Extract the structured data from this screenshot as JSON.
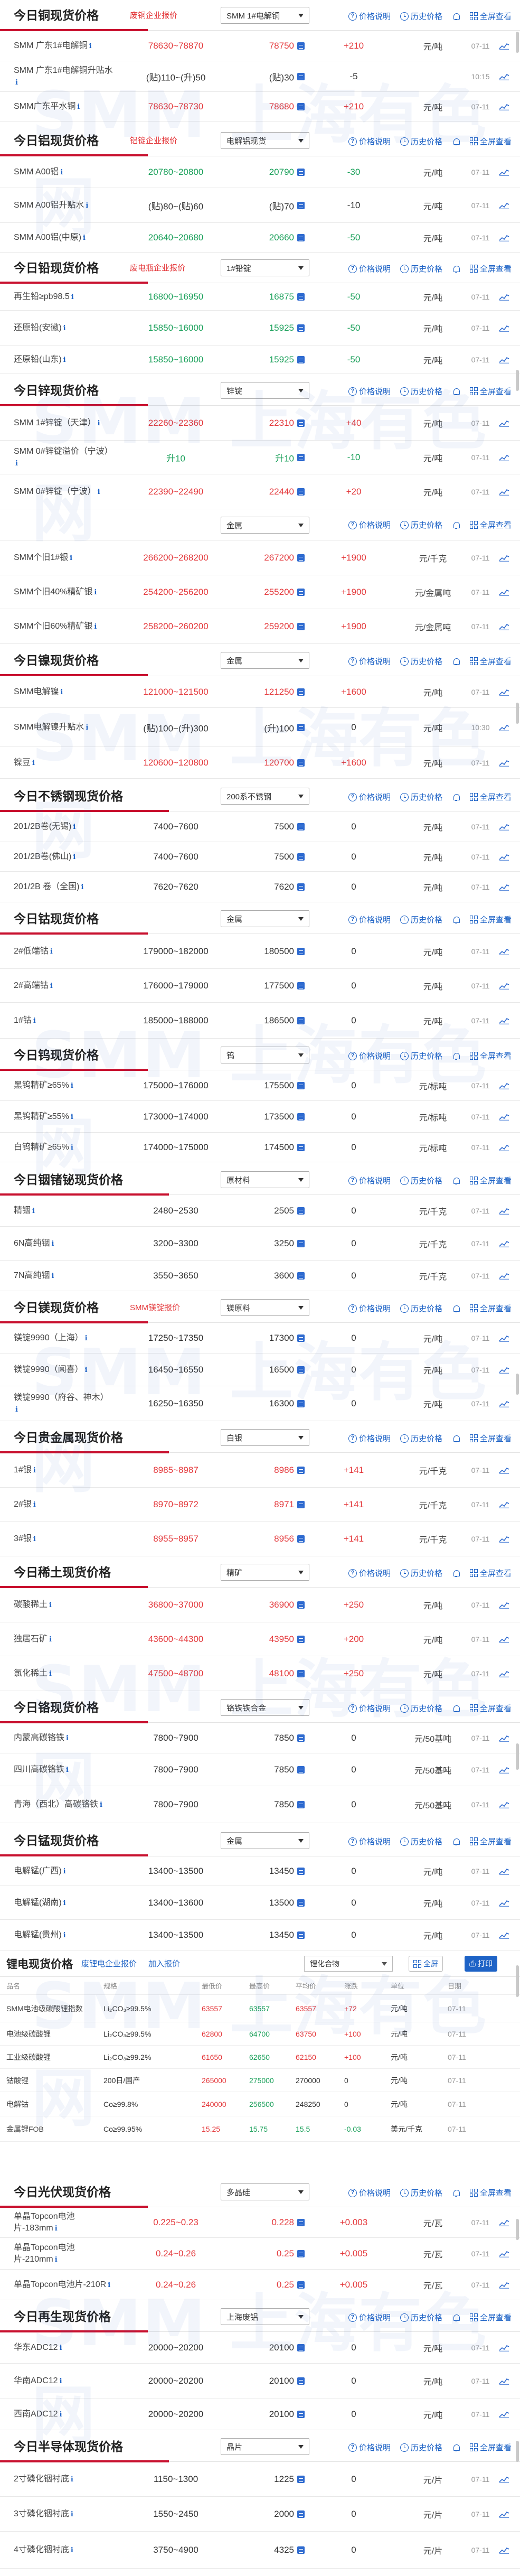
{
  "common": {
    "help": "价格说明",
    "history": "历史价格",
    "fullscreen": "全屏查看"
  },
  "copper": {
    "title": "今日铜现货价格",
    "link": "废铜企业报价",
    "select": "SMM 1#电解铜",
    "rows": [
      {
        "name": "SMM 广东1#电解铜",
        "range": "78630~78870",
        "avg": "78750",
        "chg": "+210",
        "unit": "元/吨",
        "date": "07-11",
        "dir": "up"
      },
      {
        "name": "SMM 广东1#电解铜升贴水",
        "range": "(贴)110~(升)50",
        "avg": "(贴)30",
        "chg": "-5",
        "unit": "",
        "date": "10:15",
        "dir": "none"
      },
      {
        "name": "SMM广东平水铜",
        "range": "78630~78730",
        "avg": "78680",
        "chg": "+210",
        "unit": "元/吨",
        "date": "07-11",
        "dir": "up"
      }
    ]
  },
  "aluminum": {
    "title": "今日铝现货价格",
    "link": "铝锭企业报价",
    "select": "电解铝现货",
    "rows": [
      {
        "name": "SMM A00铝",
        "range": "20780~20800",
        "avg": "20790",
        "chg": "-30",
        "unit": "元/吨",
        "date": "07-11",
        "dir": "down"
      },
      {
        "name": "SMM A00铝升贴水",
        "range": "(贴)80~(贴)60",
        "avg": "(贴)70",
        "chg": "-10",
        "unit": "元/吨",
        "date": "07-11",
        "dir": "none"
      },
      {
        "name": "SMM A00铝(中原)",
        "range": "20640~20680",
        "avg": "20660",
        "chg": "-50",
        "unit": "元/吨",
        "date": "07-11",
        "dir": "down"
      }
    ]
  },
  "lead": {
    "title": "今日铅现货价格",
    "link": "废电瓶企业报价",
    "select": "1#铅锭",
    "rows": [
      {
        "name": "再生铅≥pb98.5",
        "range": "16800~16950",
        "avg": "16875",
        "chg": "-50",
        "unit": "元/吨",
        "date": "07-11",
        "dir": "down"
      },
      {
        "name": "还原铅(安徽)",
        "range": "15850~16000",
        "avg": "15925",
        "chg": "-50",
        "unit": "元/吨",
        "date": "07-11",
        "dir": "down"
      },
      {
        "name": "还原铅(山东)",
        "range": "15850~16000",
        "avg": "15925",
        "chg": "-50",
        "unit": "元/吨",
        "date": "07-11",
        "dir": "down"
      }
    ]
  },
  "zinc": {
    "title": "今日锌现货价格",
    "select": "锌锭",
    "rows": [
      {
        "name": "SMM 1#锌锭（天津）",
        "range": "22260~22360",
        "avg": "22310",
        "chg": "+40",
        "unit": "元/吨",
        "date": "07-11",
        "dir": "up"
      },
      {
        "name": "SMM 0#锌锭溢价（宁波）",
        "range": "升10",
        "avg": "升10",
        "chg": "-10",
        "unit": "元/吨",
        "date": "07-11",
        "dir": "down"
      },
      {
        "name": "SMM 0#锌锭（宁波）",
        "range": "22390~22490",
        "avg": "22440",
        "chg": "+20",
        "unit": "元/吨",
        "date": "07-11",
        "dir": "up"
      }
    ]
  },
  "silver": {
    "select": "金属",
    "rows": [
      {
        "name": "SMM个旧1#银",
        "range": "266200~268200",
        "avg": "267200",
        "chg": "+1900",
        "unit": "元/千克",
        "date": "07-11",
        "dir": "up"
      },
      {
        "name": "SMM个旧40%精矿银",
        "range": "254200~256200",
        "avg": "255200",
        "chg": "+1900",
        "unit": "元/金属吨",
        "date": "07-11",
        "dir": "up"
      },
      {
        "name": "SMM个旧60%精矿银",
        "range": "258200~260200",
        "avg": "259200",
        "chg": "+1900",
        "unit": "元/金属吨",
        "date": "07-11",
        "dir": "up"
      }
    ]
  },
  "nickel": {
    "title": "今日镍现货价格",
    "select": "金属",
    "rows": [
      {
        "name": "SMM电解镍",
        "range": "121000~121500",
        "avg": "121250",
        "chg": "+1600",
        "unit": "元/吨",
        "date": "07-11",
        "dir": "up"
      },
      {
        "name": "SMM电解镍升贴水",
        "range": "(贴)100~(升)300",
        "avg": "(升)100",
        "chg": "0",
        "unit": "元/吨",
        "date": "10:30",
        "dir": "none"
      },
      {
        "name": "镍豆",
        "range": "120600~120800",
        "avg": "120700",
        "chg": "+1600",
        "unit": "元/吨",
        "date": "07-11",
        "dir": "up"
      }
    ]
  },
  "stainless": {
    "title": "今日不锈钢现货价格",
    "select": "200系不锈钢",
    "rows": [
      {
        "name": "201/2B卷(无锡)",
        "range": "7400~7600",
        "avg": "7500",
        "chg": "0",
        "unit": "元/吨",
        "date": "07-11",
        "dir": "none"
      },
      {
        "name": "201/2B卷(佛山)",
        "range": "7400~7600",
        "avg": "7500",
        "chg": "0",
        "unit": "元/吨",
        "date": "07-11",
        "dir": "none"
      },
      {
        "name": "201/2B 卷（全国)",
        "range": "7620~7620",
        "avg": "7620",
        "chg": "0",
        "unit": "元/吨",
        "date": "07-11",
        "dir": "none"
      }
    ]
  },
  "cobalt": {
    "title": "今日钴现货价格",
    "select": "金属",
    "rows": [
      {
        "name": "2#低端钴",
        "range": "179000~182000",
        "avg": "180500",
        "chg": "0",
        "unit": "元/吨",
        "date": "07-11",
        "dir": "none"
      },
      {
        "name": "2#高端钴",
        "range": "176000~179000",
        "avg": "177500",
        "chg": "0",
        "unit": "元/吨",
        "date": "07-11",
        "dir": "none"
      },
      {
        "name": "1#钴",
        "range": "185000~188000",
        "avg": "186500",
        "chg": "0",
        "unit": "元/吨",
        "date": "07-11",
        "dir": "none"
      }
    ]
  },
  "tungsten": {
    "title": "今日钨现货价格",
    "select": "钨",
    "rows": [
      {
        "name": "黑钨精矿≥65%",
        "range": "175000~176000",
        "avg": "175500",
        "chg": "0",
        "unit": "元/标吨",
        "date": "07-11",
        "dir": "none"
      },
      {
        "name": "黑钨精矿≥55%",
        "range": "173000~174000",
        "avg": "173500",
        "chg": "0",
        "unit": "元/标吨",
        "date": "07-11",
        "dir": "none"
      },
      {
        "name": "白钨精矿≥65%",
        "range": "174000~175000",
        "avg": "174500",
        "chg": "0",
        "unit": "元/标吨",
        "date": "07-11",
        "dir": "none"
      }
    ]
  },
  "indium": {
    "title": "今日铟锗铋现货价格",
    "select": "原材料",
    "rows": [
      {
        "name": "精铟",
        "range": "2480~2530",
        "avg": "2505",
        "chg": "0",
        "unit": "元/千克",
        "date": "07-11",
        "dir": "none"
      },
      {
        "name": "6N高纯铟",
        "range": "3200~3300",
        "avg": "3250",
        "chg": "0",
        "unit": "元/千克",
        "date": "07-11",
        "dir": "none"
      },
      {
        "name": "7N高纯铟",
        "range": "3550~3650",
        "avg": "3600",
        "chg": "0",
        "unit": "元/千克",
        "date": "07-11",
        "dir": "none"
      }
    ]
  },
  "magnesium": {
    "title": "今日镁现货价格",
    "link": "SMM镁锭报价",
    "select": "镁原料",
    "rows": [
      {
        "name": "镁锭9990（上海）",
        "range": "17250~17350",
        "avg": "17300",
        "chg": "0",
        "unit": "元/吨",
        "date": "07-11",
        "dir": "none"
      },
      {
        "name": "镁锭9990（闻喜）",
        "range": "16450~16550",
        "avg": "16500",
        "chg": "0",
        "unit": "元/吨",
        "date": "07-11",
        "dir": "none"
      },
      {
        "name": "镁锭9990（府谷、神木）",
        "range": "16250~16350",
        "avg": "16300",
        "chg": "0",
        "unit": "元/吨",
        "date": "07-11",
        "dir": "none"
      }
    ]
  },
  "precious": {
    "title": "今日贵金属现货价格",
    "select": "白银",
    "rows": [
      {
        "name": "1#银",
        "range": "8985~8987",
        "avg": "8986",
        "chg": "+141",
        "unit": "元/千克",
        "date": "07-11",
        "dir": "up"
      },
      {
        "name": "2#银",
        "range": "8970~8972",
        "avg": "8971",
        "chg": "+141",
        "unit": "元/千克",
        "date": "07-11",
        "dir": "up"
      },
      {
        "name": "3#银",
        "range": "8955~8957",
        "avg": "8956",
        "chg": "+141",
        "unit": "元/千克",
        "date": "07-11",
        "dir": "up"
      }
    ]
  },
  "rare_earth": {
    "title": "今日稀土现货价格",
    "select": "精矿",
    "rows": [
      {
        "name": "碳酸稀土",
        "range": "36800~37000",
        "avg": "36900",
        "chg": "+250",
        "unit": "元/吨",
        "date": "07-11",
        "dir": "up"
      },
      {
        "name": "独居石矿",
        "range": "43600~44300",
        "avg": "43950",
        "chg": "+200",
        "unit": "元/吨",
        "date": "07-11",
        "dir": "up"
      },
      {
        "name": "氯化稀土",
        "range": "47500~48700",
        "avg": "48100",
        "chg": "+250",
        "unit": "元/吨",
        "date": "07-11",
        "dir": "up"
      }
    ]
  },
  "chromium": {
    "title": "今日铬现货价格",
    "select": "铬铁铁合金",
    "rows": [
      {
        "name": "内蒙高碳铬铁",
        "range": "7800~7900",
        "avg": "7850",
        "chg": "0",
        "unit": "元/50基吨",
        "date": "07-11",
        "dir": "none"
      },
      {
        "name": "四川高碳铬铁",
        "range": "7800~7900",
        "avg": "7850",
        "chg": "0",
        "unit": "元/50基吨",
        "date": "07-11",
        "dir": "none"
      },
      {
        "name": "青海（西北）高碳铬铁",
        "range": "7800~7900",
        "avg": "7850",
        "chg": "0",
        "unit": "元/50基吨",
        "date": "07-11",
        "dir": "none"
      }
    ]
  },
  "manganese": {
    "title": "今日锰现货价格",
    "select": "金属",
    "rows": [
      {
        "name": "电解锰(广西)",
        "range": "13400~13500",
        "avg": "13450",
        "chg": "0",
        "unit": "元/吨",
        "date": "07-11",
        "dir": "none"
      },
      {
        "name": "电解锰(湖南)",
        "range": "13400~13600",
        "avg": "13500",
        "chg": "0",
        "unit": "元/吨",
        "date": "07-11",
        "dir": "none"
      },
      {
        "name": "电解锰(贵州)",
        "range": "13400~13500",
        "avg": "13450",
        "chg": "0",
        "unit": "元/吨",
        "date": "07-11",
        "dir": "none"
      }
    ]
  },
  "lithium": {
    "title": "锂电现货价格",
    "link1": "废锂电企业报价",
    "link2": "加入报价",
    "select": "锂化合物",
    "btn_full": "全屏",
    "btn_print": "打印",
    "headers": [
      "品名",
      "规格",
      "最低价",
      "最高价",
      "平均价",
      "涨跌",
      "单位",
      "日期"
    ],
    "rows": [
      {
        "name": "SMM电池级碳酸锂指数",
        "spec": "Li₂CO₃≥99.5%",
        "low": "63557",
        "high": "63557",
        "avg": "63557",
        "chg": "+72",
        "unit": "元/吨",
        "date": "07-11",
        "dir": "up"
      },
      {
        "name": "电池级碳酸锂",
        "spec": "Li₂CO₃≥99.5%",
        "low": "62800",
        "high": "64700",
        "avg": "63750",
        "chg": "+100",
        "unit": "元/吨",
        "date": "07-11",
        "dir": "up"
      },
      {
        "name": "工业级碳酸锂",
        "spec": "Li₂CO₃≥99.2%",
        "low": "61650",
        "high": "62650",
        "avg": "62150",
        "chg": "+100",
        "unit": "元/吨",
        "date": "07-11",
        "dir": "up"
      },
      {
        "name": "钴酸锂",
        "spec": "200日/国产",
        "low": "265000",
        "high": "275000",
        "avg": "270000",
        "chg": "0",
        "unit": "元/吨",
        "date": "07-11",
        "dir": "none"
      },
      {
        "name": "电解钴",
        "spec": "Co≥99.8%",
        "low": "240000",
        "high": "256500",
        "avg": "248250",
        "chg": "0",
        "unit": "元/吨",
        "date": "07-11",
        "dir": "none"
      },
      {
        "name": "金属锂FOB",
        "spec": "Co≥99.95%",
        "low": "15.25",
        "high": "15.75",
        "avg": "15.5",
        "chg": "-0.03",
        "unit": "美元/千克",
        "date": "07-11",
        "dir": "down"
      }
    ]
  },
  "pv": {
    "title": "今日光伏现货价格",
    "select": "多晶硅",
    "rows": [
      {
        "name": "单晶Topcon电池片-183mm",
        "range": "0.225~0.23",
        "avg": "0.228",
        "chg": "+0.003",
        "unit": "元/瓦",
        "date": "07-11",
        "dir": "up"
      },
      {
        "name": "单晶Topcon电池片-210mm",
        "range": "0.24~0.26",
        "avg": "0.25",
        "chg": "+0.005",
        "unit": "元/瓦",
        "date": "07-11",
        "dir": "up"
      },
      {
        "name": "单晶Topcon电池片-210R",
        "range": "0.24~0.26",
        "avg": "0.25",
        "chg": "+0.005",
        "unit": "元/瓦",
        "date": "07-11",
        "dir": "up"
      }
    ]
  },
  "recycled": {
    "title": "今日再生现货价格",
    "select": "上海废铝",
    "rows": [
      {
        "name": "华东ADC12",
        "range": "20000~20200",
        "avg": "20100",
        "chg": "0",
        "unit": "元/吨",
        "date": "07-11",
        "dir": "none"
      },
      {
        "name": "华南ADC12",
        "range": "20000~20200",
        "avg": "20100",
        "chg": "0",
        "unit": "元/吨",
        "date": "07-11",
        "dir": "none"
      },
      {
        "name": "西南ADC12",
        "range": "20000~20200",
        "avg": "20100",
        "chg": "0",
        "unit": "元/吨",
        "date": "07-11",
        "dir": "none"
      }
    ]
  },
  "semi": {
    "title": "今日半导体现货价格",
    "select": "晶片",
    "rows": [
      {
        "name": "2寸磷化铟衬底",
        "range": "1150~1300",
        "avg": "1225",
        "chg": "0",
        "unit": "元/片",
        "date": "07-11",
        "dir": "none"
      },
      {
        "name": "3寸磷化铟衬底",
        "range": "1550~2450",
        "avg": "2000",
        "chg": "0",
        "unit": "元/片",
        "date": "07-11",
        "dir": "none"
      },
      {
        "name": "4寸磷化铟衬底",
        "range": "3750~4900",
        "avg": "4325",
        "chg": "0",
        "unit": "元/片",
        "date": "07-11",
        "dir": "none"
      }
    ]
  },
  "watermark": "SMM 上海有色网",
  "colors": {
    "up": "#e4393c",
    "down": "#1aa05a",
    "accent": "#c8102e",
    "link": "#1e63c6"
  }
}
